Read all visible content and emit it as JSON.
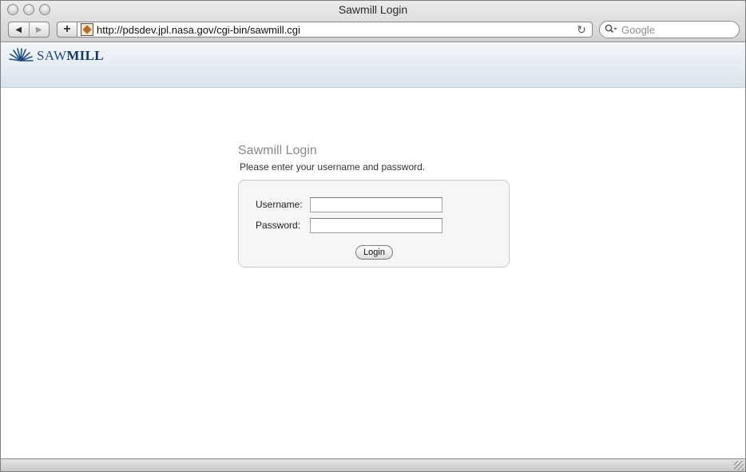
{
  "window": {
    "title": "Sawmill Login"
  },
  "toolbar": {
    "back_glyph": "◀",
    "forward_glyph": "▶",
    "add_glyph": "+",
    "url": "http://pdsdev.jpl.nasa.gov/cgi-bin/sawmill.cgi",
    "reload_glyph": "↻",
    "search_placeholder": "Google",
    "search_glyph": "🔍▾"
  },
  "header": {
    "logo_prefix": "SAW",
    "logo_suffix": "MILL",
    "logo_icon": "sawmill-logo-icon"
  },
  "login": {
    "title": "Sawmill Login",
    "subtitle": "Please enter your username and password.",
    "username_label": "Username:",
    "username_value": "",
    "password_label": "Password:",
    "password_value": "",
    "submit_label": "Login"
  },
  "colors": {
    "logo_blue": "#1e4d86",
    "header_bg_top": "#f3f6fa",
    "header_bg_bottom": "#dbe3ec",
    "login_box_bg": "#f6f6f6"
  }
}
